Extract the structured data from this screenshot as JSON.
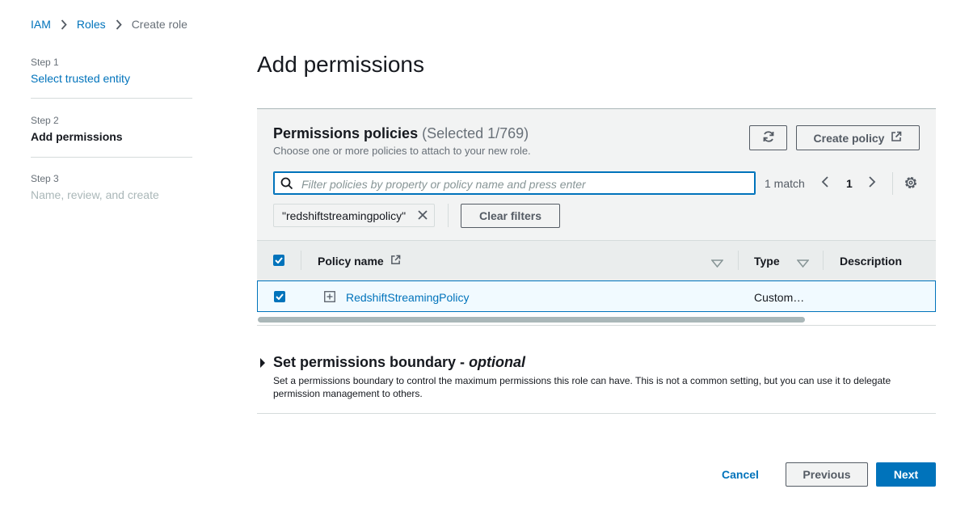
{
  "breadcrumb": {
    "items": [
      {
        "label": "IAM"
      },
      {
        "label": "Roles"
      },
      {
        "label": "Create role"
      }
    ]
  },
  "steps": [
    {
      "number": "Step 1",
      "label": "Select trusted entity",
      "state": "link"
    },
    {
      "number": "Step 2",
      "label": "Add permissions",
      "state": "current"
    },
    {
      "number": "Step 3",
      "label": "Name, review, and create",
      "state": "disabled"
    }
  ],
  "page_title": "Add permissions",
  "permissions": {
    "title": "Permissions policies",
    "selected_count": "(Selected 1/769)",
    "description": "Choose one or more policies to attach to your new role.",
    "refresh_icon": "refresh-icon",
    "create_policy_label": "Create policy",
    "search_placeholder": "Filter policies by property or policy name and press enter",
    "search_value": "",
    "match_text": "1 match",
    "current_page": "1",
    "filter_token": "\"redshiftstreamingpolicy\"",
    "clear_filters_label": "Clear filters"
  },
  "table": {
    "columns": [
      "Policy name",
      "Type",
      "Description"
    ],
    "rows": [
      {
        "policy_name": "RedshiftStreamingPolicy",
        "type": "Custom…",
        "description": "",
        "checked": true
      }
    ]
  },
  "boundary": {
    "title": "Set permissions boundary - ",
    "title_optional": "optional",
    "description": "Set a permissions boundary to control the maximum permissions this role can have. This is not a common setting, but you can use it to delegate permission management to others."
  },
  "footer": {
    "cancel_label": "Cancel",
    "previous_label": "Previous",
    "next_label": "Next"
  },
  "colors": {
    "accent": "#0073bb",
    "panel_bg": "#f2f3f3",
    "selected_row_bg": "#f1faff"
  }
}
